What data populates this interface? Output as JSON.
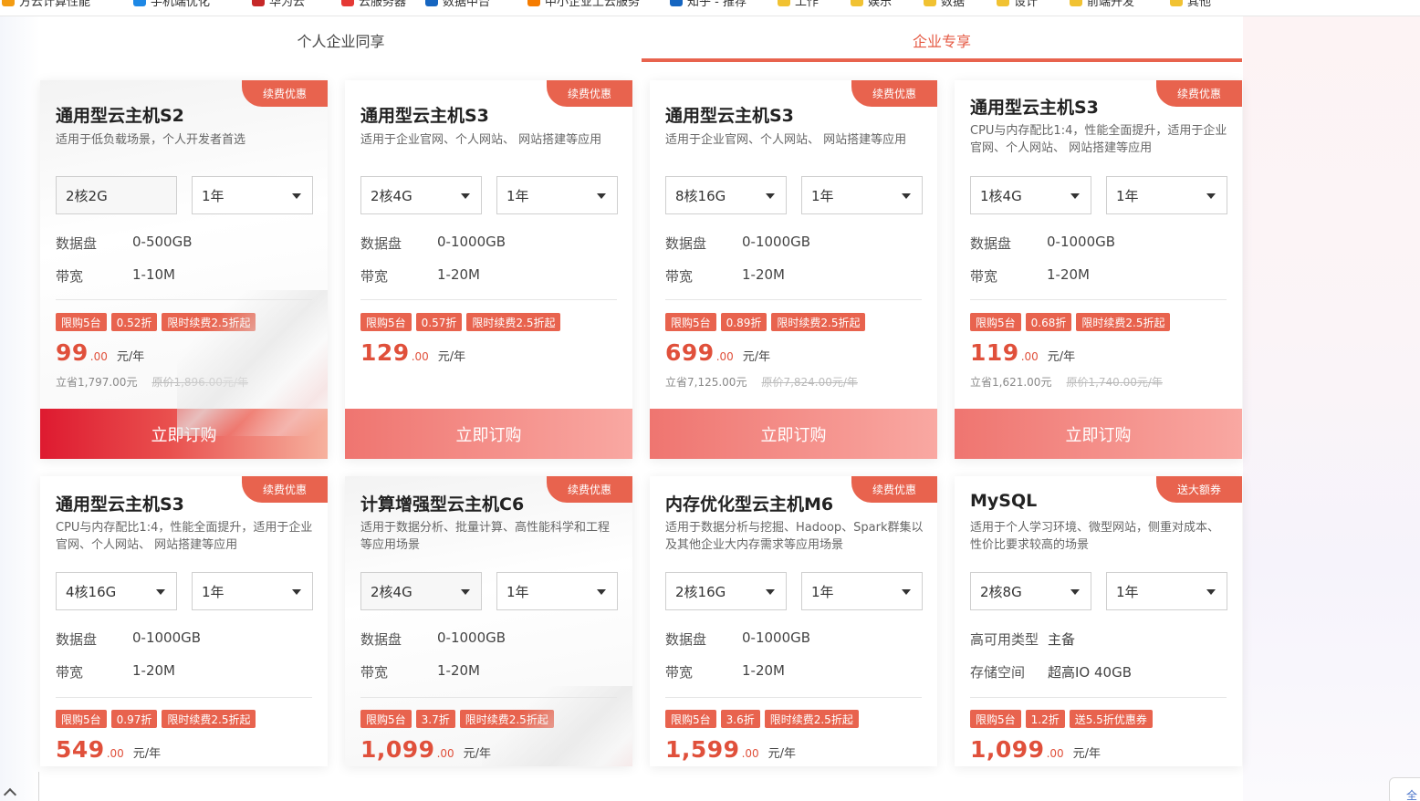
{
  "bookmarks": [
    {
      "label": "方云计算性能",
      "color": "#f39c12"
    },
    {
      "label": "手机端优化",
      "color": "#1e88e5"
    },
    {
      "label": "华为云",
      "color": "#c62828"
    },
    {
      "label": "云服务器",
      "color": "#e53935"
    },
    {
      "label": "数据中台",
      "color": "#1565c0"
    },
    {
      "label": "中小企业上云服务",
      "color": "#f57c00"
    },
    {
      "label": "知乎 - 推荐",
      "color": "#1565c0"
    },
    {
      "label": "工作",
      "color": "#f1c232"
    },
    {
      "label": "娱乐",
      "color": "#f1c232"
    },
    {
      "label": "数据",
      "color": "#f1c232"
    },
    {
      "label": "设计",
      "color": "#f1c232"
    },
    {
      "label": "前端开发",
      "color": "#f1c232"
    },
    {
      "label": "其他",
      "color": "#f1c232"
    }
  ],
  "tabs": {
    "personal": "个人企业同享",
    "enterprise": "企业专享"
  },
  "colors": {
    "accent": "#e8634e",
    "price": "#e0503b"
  },
  "cards": [
    {
      "ribbon": "续费优惠",
      "title": "通用型云主机S2",
      "desc": "适用于低负载场景，个人开发者首选",
      "spec": "2核2G",
      "duration": "1年",
      "disk_label": "数据盘",
      "disk_value": "0-500GB",
      "bw_label": "带宽",
      "bw_value": "1-10M",
      "badges": [
        "限购5台",
        "0.52折",
        "限时续费2.5折起"
      ],
      "price_int": "99",
      "price_dec": ".00",
      "unit": "元/年",
      "save": "立省1,797.00元",
      "original": "原价1,896.00元/年",
      "buy": "立即订购"
    },
    {
      "ribbon": "续费优惠",
      "title": "通用型云主机S3",
      "desc": "适用于企业官网、个人网站、 网站搭建等应用",
      "spec": "2核4G",
      "duration": "1年",
      "disk_label": "数据盘",
      "disk_value": "0-1000GB",
      "bw_label": "带宽",
      "bw_value": "1-20M",
      "badges": [
        "限购5台",
        "0.57折",
        "限时续费2.5折起"
      ],
      "price_int": "129",
      "price_dec": ".00",
      "unit": "元/年",
      "save": "",
      "original": "",
      "buy": "立即订购"
    },
    {
      "ribbon": "续费优惠",
      "title": "通用型云主机S3",
      "desc": "适用于企业官网、个人网站、 网站搭建等应用",
      "spec": "8核16G",
      "duration": "1年",
      "disk_label": "数据盘",
      "disk_value": "0-1000GB",
      "bw_label": "带宽",
      "bw_value": "1-20M",
      "badges": [
        "限购5台",
        "0.89折",
        "限时续费2.5折起"
      ],
      "price_int": "699",
      "price_dec": ".00",
      "unit": "元/年",
      "save": "立省7,125.00元",
      "original": "原价7,824.00元/年",
      "buy": "立即订购"
    },
    {
      "ribbon": "续费优惠",
      "title": "通用型云主机S3",
      "desc": "CPU与内存配比1:4，性能全面提升，适用于企业官网、个人网站、 网站搭建等应用",
      "spec": "1核4G",
      "duration": "1年",
      "disk_label": "数据盘",
      "disk_value": "0-1000GB",
      "bw_label": "带宽",
      "bw_value": "1-20M",
      "badges": [
        "限购5台",
        "0.68折",
        "限时续费2.5折起"
      ],
      "price_int": "119",
      "price_dec": ".00",
      "unit": "元/年",
      "save": "立省1,621.00元",
      "original": "原价1,740.00元/年",
      "buy": "立即订购"
    },
    {
      "ribbon": "续费优惠",
      "title": "通用型云主机S3",
      "desc": "CPU与内存配比1:4，性能全面提升，适用于企业官网、个人网站、 网站搭建等应用",
      "spec": "4核16G",
      "duration": "1年",
      "disk_label": "数据盘",
      "disk_value": "0-1000GB",
      "bw_label": "带宽",
      "bw_value": "1-20M",
      "badges": [
        "限购5台",
        "0.97折",
        "限时续费2.5折起"
      ],
      "price_int": "549",
      "price_dec": ".00",
      "unit": "元/年"
    },
    {
      "ribbon": "续费优惠",
      "title": "计算增强型云主机C6",
      "desc": "适用于数据分析、批量计算、高性能科学和工程等应用场景",
      "spec": "2核4G",
      "duration": "1年",
      "disk_label": "数据盘",
      "disk_value": "0-1000GB",
      "bw_label": "带宽",
      "bw_value": "1-20M",
      "badges": [
        "限购5台",
        "3.7折",
        "限时续费2.5折起"
      ],
      "price_int": "1,099",
      "price_dec": ".00",
      "unit": "元/年"
    },
    {
      "ribbon": "续费优惠",
      "title": "内存优化型云主机M6",
      "desc": "适用于数据分析与挖掘、Hadoop、Spark群集以及其他企业大内存需求等应用场景",
      "spec": "2核16G",
      "duration": "1年",
      "disk_label": "数据盘",
      "disk_value": "0-1000GB",
      "bw_label": "带宽",
      "bw_value": "1-20M",
      "badges": [
        "限购5台",
        "3.6折",
        "限时续费2.5折起"
      ],
      "price_int": "1,599",
      "price_dec": ".00",
      "unit": "元/年"
    },
    {
      "ribbon": "送大额券",
      "title": "MySQL",
      "desc": "适用于个人学习环境、微型网站，侧重对成本、性价比要求较高的场景",
      "spec": "2核8G",
      "duration": "1年",
      "disk_label": "高可用类型",
      "disk_value": "主备",
      "bw_label": "存储空间",
      "bw_value": "超高IO 40GB",
      "badges": [
        "限购5台",
        "1.2折",
        "送5.5折优惠券"
      ],
      "price_int": "1,099",
      "price_dec": ".00",
      "unit": "元/年"
    }
  ],
  "corner_widget": "全"
}
